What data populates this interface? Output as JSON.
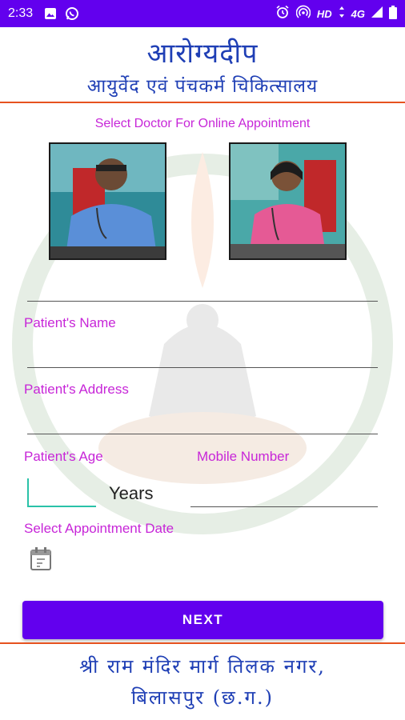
{
  "status_bar": {
    "time": "2:33",
    "network_label": "HD",
    "signal_label": "4G",
    "icons": [
      "image-icon",
      "whatsapp-icon",
      "alarm-icon",
      "hotspot-icon",
      "data-arrows-icon",
      "signal-icon",
      "battery-icon"
    ]
  },
  "header": {
    "title": "आरोग्यदीप",
    "subtitle": "आयुर्वेद एवं पंचकर्म चिकित्सालय"
  },
  "doctor_section": {
    "heading": "Select Doctor For Online Appointment"
  },
  "form": {
    "patient_name_label": "Patient's Name",
    "patient_name_value": "",
    "patient_address_label": "Patient's Address",
    "patient_address_value": "",
    "patient_age_label": "Patient's Age",
    "patient_age_value": "",
    "age_unit": "Years",
    "mobile_label": "Mobile Number",
    "mobile_value": "",
    "date_label": "Select Appointment Date"
  },
  "next_button": {
    "label": "NEXT"
  },
  "footer": {
    "line1": "श्री राम मंदिर मार्ग तिलक नगर,",
    "line2": "बिलासपुर (छ.ग.)"
  },
  "colors": {
    "primary": "#6200ee",
    "label_magenta": "#c726d8",
    "heading_blue": "#1f3fb5",
    "divider_orange": "#e6521f",
    "focus_teal": "#2ac2a8"
  }
}
